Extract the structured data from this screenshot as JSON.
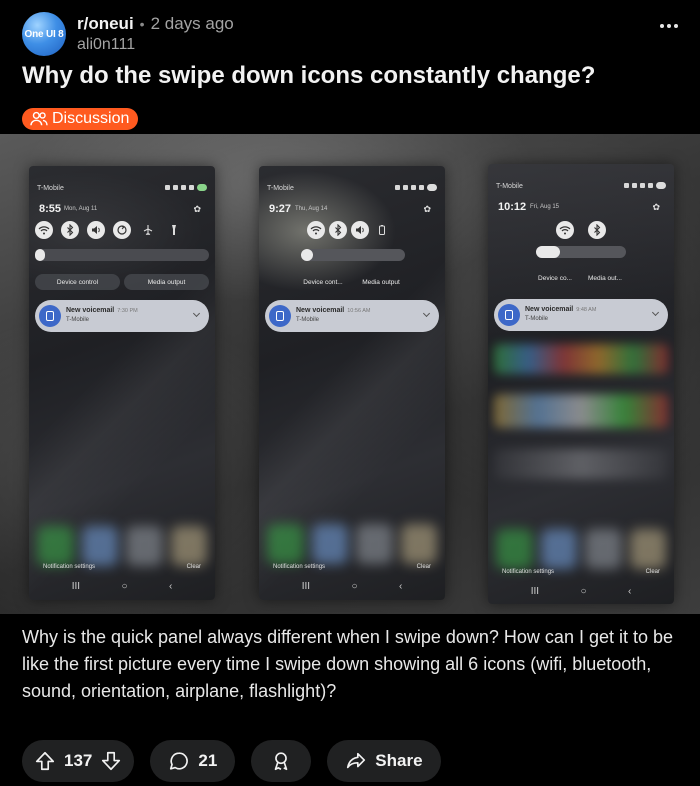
{
  "post": {
    "avatar_text": "One UI 8",
    "subreddit": "r/oneui",
    "time_ago": "2 days ago",
    "author": "ali0n111",
    "title": "Why do the swipe down icons constantly change?",
    "flair": "Discussion",
    "body": "Why is the quick panel always different when I swipe down? How can I get it to be like the first picture every time I swipe down showing all 6 icons (wifi, bluetooth, sound, orientation, airplane, flashlight)?"
  },
  "screenshots": [
    {
      "carrier": "T-Mobile",
      "time": "8:55",
      "date": "Mon, Aug 11",
      "tiles": [
        "wifi-icon",
        "bluetooth-icon",
        "sound-icon",
        "orientation-icon",
        "airplane-icon",
        "flashlight-icon"
      ],
      "buttons": [
        "Device control",
        "Media output"
      ],
      "notification_title": "New voicemail",
      "notification_time": "7:30 PM",
      "notification_sub": "T-Mobile",
      "footer_left": "Notification settings",
      "footer_right": "Clear"
    },
    {
      "carrier": "T-Mobile",
      "time": "9:27",
      "date": "Thu, Aug 14",
      "tiles": [
        "wifi-icon",
        "bluetooth-icon",
        "sound-icon",
        "battery-icon"
      ],
      "buttons": [
        "Device cont...",
        "Media output"
      ],
      "notification_title": "New voicemail",
      "notification_time": "10:56 AM",
      "notification_sub": "T-Mobile",
      "footer_left": "Notification settings",
      "footer_right": "Clear"
    },
    {
      "carrier": "T-Mobile",
      "time": "10:12",
      "date": "Fri, Aug 15",
      "tiles": [
        "wifi-icon",
        "bluetooth-icon"
      ],
      "buttons": [
        "Device co...",
        "Media out..."
      ],
      "notification_title": "New voicemail",
      "notification_time": "9:48 AM",
      "notification_sub": "T-Mobile",
      "footer_left": "Notification settings",
      "footer_right": "Clear"
    }
  ],
  "actions": {
    "upvotes": "137",
    "comments": "21",
    "share_label": "Share"
  },
  "colors": {
    "flair_bg": "#ff5a1f",
    "background": "#000000",
    "pill_bg": "#202122"
  }
}
